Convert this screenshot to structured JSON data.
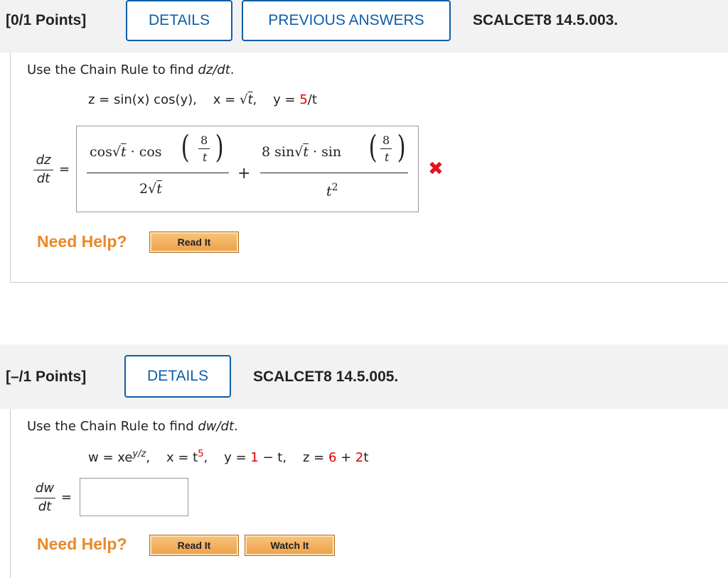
{
  "q1": {
    "points": "[0/1 Points]",
    "details_label": "DETAILS",
    "previous_label": "PREVIOUS ANSWERS",
    "code": "SCALCET8 14.5.003.",
    "prompt_prefix": "Use the Chain Rule to find ",
    "prompt_var": "dz/dt",
    "prompt_suffix": ".",
    "equation": {
      "z_def": "z = sin(x) cos(y),",
      "x_def_prefix": "x = ",
      "x_def_root": "t",
      "x_def_suffix": ",",
      "y_def_prefix": "y = ",
      "y_def_value": "5",
      "y_def_suffix": "/t"
    },
    "lhs_num": "dz",
    "lhs_den": "dt",
    "equals": "=",
    "answer": {
      "term1_num_a": "cos",
      "term1_num_b": "t",
      "term1_num_c": " · cos",
      "term1_inner_num": "8",
      "term1_inner_den": "t",
      "term1_den_a": "2",
      "term1_den_b": "t",
      "plus": "+",
      "term2_num_a": "8 sin",
      "term2_num_b": "t",
      "term2_num_c": " · sin",
      "term2_inner_num": "8",
      "term2_inner_den": "t",
      "term2_den": "t",
      "term2_den_exp": "2"
    },
    "status_icon": "x-mark-icon",
    "need_help": "Need Help?",
    "read_it": "Read It"
  },
  "q2": {
    "points": "[–/1 Points]",
    "details_label": "DETAILS",
    "code": "SCALCET8 14.5.005.",
    "prompt_prefix": "Use the Chain Rule to find ",
    "prompt_var": "dw/dt",
    "prompt_suffix": ".",
    "equation": {
      "w_prefix": "w = xe",
      "w_exp": "y/z",
      "w_suffix": ",",
      "x_prefix": "x = t",
      "x_exp": "5",
      "x_suffix": ",",
      "y_prefix": "y = ",
      "y_val1": "1",
      "y_mid": " − t,",
      "z_prefix": "z = ",
      "z_val1": "6",
      "z_mid": " + ",
      "z_val2": "2",
      "z_suffix": "t"
    },
    "lhs_num": "dw",
    "lhs_den": "dt",
    "equals": "=",
    "answer_value": "",
    "need_help": "Need Help?",
    "read_it": "Read It",
    "watch_it": "Watch It"
  },
  "colors": {
    "accent_blue": "#0d5ea8",
    "given_red": "#e00000",
    "help_orange": "#e8892a",
    "wrong_red": "#e0141e"
  }
}
